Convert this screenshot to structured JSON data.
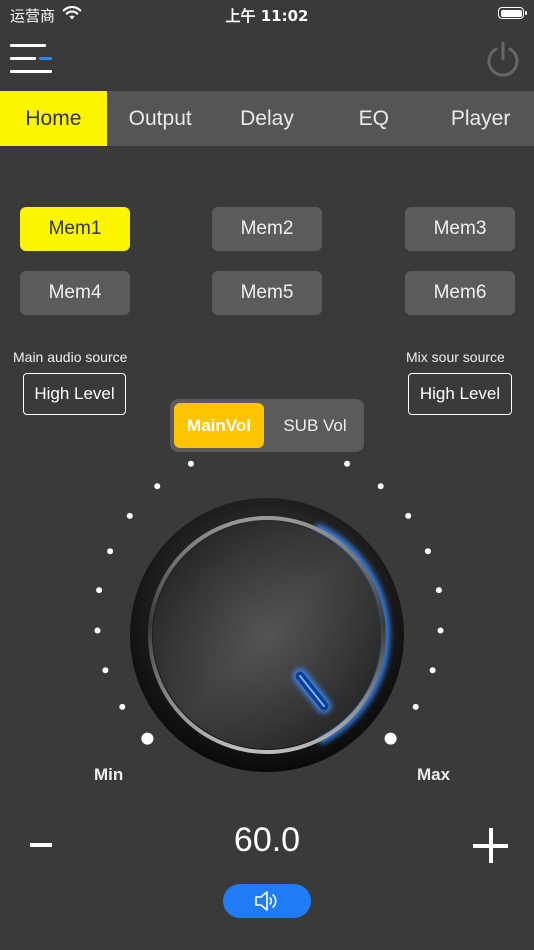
{
  "status_bar": {
    "carrier": "运营商",
    "time": "上午 11:02"
  },
  "tabs": [
    {
      "label": "Home",
      "active": true
    },
    {
      "label": "Output",
      "active": false
    },
    {
      "label": "Delay",
      "active": false
    },
    {
      "label": "EQ",
      "active": false
    },
    {
      "label": "Player",
      "active": false
    }
  ],
  "memory": [
    "Mem1",
    "Mem2",
    "Mem3",
    "Mem4",
    "Mem5",
    "Mem6"
  ],
  "active_memory": "Mem1",
  "main_source": {
    "label": "Main audio source",
    "value": "High Level"
  },
  "mix_source": {
    "label": "Mix sour source",
    "value": "High Level"
  },
  "volume_toggle": {
    "main": "MainVol",
    "sub": "SUB Vol",
    "selected": "MainVol"
  },
  "volume": {
    "min_label": "Min",
    "max_label": "Max",
    "value": "60.0"
  },
  "colors": {
    "accent_yellow": "#fcf500",
    "toggle_yellow": "#ffc400",
    "blue": "#1f7cf5",
    "glow": "#3b8cff"
  },
  "icons": {
    "menu": "menu-icon",
    "power": "power-icon",
    "speaker": "speaker-icon"
  }
}
